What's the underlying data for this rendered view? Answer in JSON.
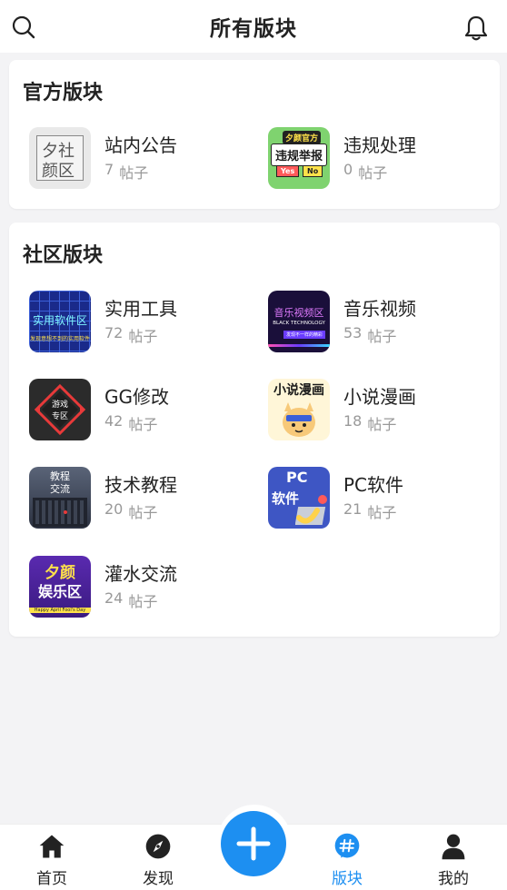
{
  "header": {
    "title": "所有版块"
  },
  "sections": [
    {
      "title": "官方版块",
      "boards": [
        {
          "name": "站内公告",
          "count": "7",
          "unit": "帖子",
          "thumb_text": [
            "夕社",
            "颜区"
          ]
        },
        {
          "name": "违规处理",
          "count": "0",
          "unit": "帖子",
          "thumb_text": [
            "夕颜官方",
            "违规举报",
            "Yes",
            "No"
          ]
        }
      ]
    },
    {
      "title": "社区版块",
      "boards": [
        {
          "name": "实用工具",
          "count": "72",
          "unit": "帖子",
          "thumb_text": [
            "实用软件区",
            "发现意想不到的实用软件"
          ]
        },
        {
          "name": "音乐视频",
          "count": "53",
          "unit": "帖子",
          "thumb_text": [
            "音乐视频区",
            "BLACK TECHNOLOGY",
            "发现不一样的精彩"
          ]
        },
        {
          "name": "GG修改",
          "count": "42",
          "unit": "帖子",
          "thumb_text": [
            "游戏",
            "专区"
          ]
        },
        {
          "name": "小说漫画",
          "count": "18",
          "unit": "帖子",
          "thumb_text": [
            "小说漫画"
          ]
        },
        {
          "name": "技术教程",
          "count": "20",
          "unit": "帖子",
          "thumb_text": [
            "教程",
            "交流"
          ]
        },
        {
          "name": "PC软件",
          "count": "21",
          "unit": "帖子",
          "thumb_text": [
            "PC",
            "软件"
          ]
        },
        {
          "name": "灌水交流",
          "count": "24",
          "unit": "帖子",
          "thumb_text": [
            "夕颜",
            "娱乐区",
            "Happy April Fool's Day"
          ]
        }
      ]
    }
  ],
  "tabbar": {
    "tabs": [
      {
        "label": "首页",
        "icon": "home-icon"
      },
      {
        "label": "发现",
        "icon": "compass-icon"
      },
      {
        "label": "版块",
        "icon": "hashtag-icon",
        "active": true
      },
      {
        "label": "我的",
        "icon": "user-icon"
      }
    ],
    "fab_icon": "plus-icon"
  },
  "colors": {
    "accent": "#1d8ff1",
    "background": "#f3f3f5",
    "text": "#222222",
    "muted": "#999999"
  }
}
